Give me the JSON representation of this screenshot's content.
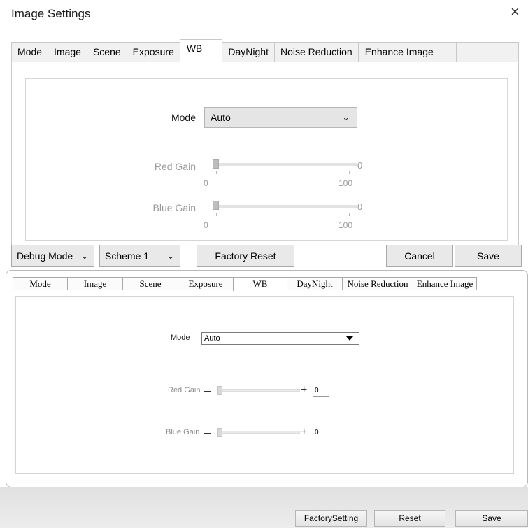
{
  "dialog": {
    "title": "Image Settings",
    "close_glyph": "×"
  },
  "top_tabs": [
    "Mode",
    "Image",
    "Scene",
    "Exposure",
    "WB",
    "DayNight",
    "Noise Reduction",
    "Enhance Image"
  ],
  "top_active_tab": "WB",
  "wb": {
    "mode_label": "Mode",
    "mode_value": "Auto",
    "red_gain": {
      "label": "Red Gain",
      "value": "0",
      "min": "0",
      "max": "100"
    },
    "blue_gain": {
      "label": "Blue Gain",
      "value": "0",
      "min": "0",
      "max": "100"
    }
  },
  "bottom_bar": {
    "debug_mode": "Debug Mod​e",
    "scheme": "Scheme 1",
    "factory_reset": "Factory Reset",
    "cancel": "Cancel",
    "save": "Save"
  },
  "legacy": {
    "tabs": [
      "Mode",
      "Image",
      "Scene",
      "Exposure",
      "WB",
      "DayNight",
      "Noise Reduction",
      "Enhance Image"
    ],
    "active_tab": "WB",
    "mode_label": "Mode",
    "mode_value": "Auto",
    "red_gain": {
      "label": "Red Gain",
      "value": "0"
    },
    "blue_gain": {
      "label": "Blue Gain",
      "value": "0"
    },
    "minus_glyph": "—",
    "plus_glyph": "+",
    "factory_setting": "FactorySetting",
    "reset": "Reset",
    "save": "Save"
  },
  "icons": {
    "chevron": "chevron-down-icon",
    "close": "close-icon",
    "dropdown": "triangle-down-icon"
  },
  "colors": {
    "accent_grey": "#e5e5e5",
    "disabled_text": "#9a9a9a",
    "border": "#c9c9c9"
  }
}
